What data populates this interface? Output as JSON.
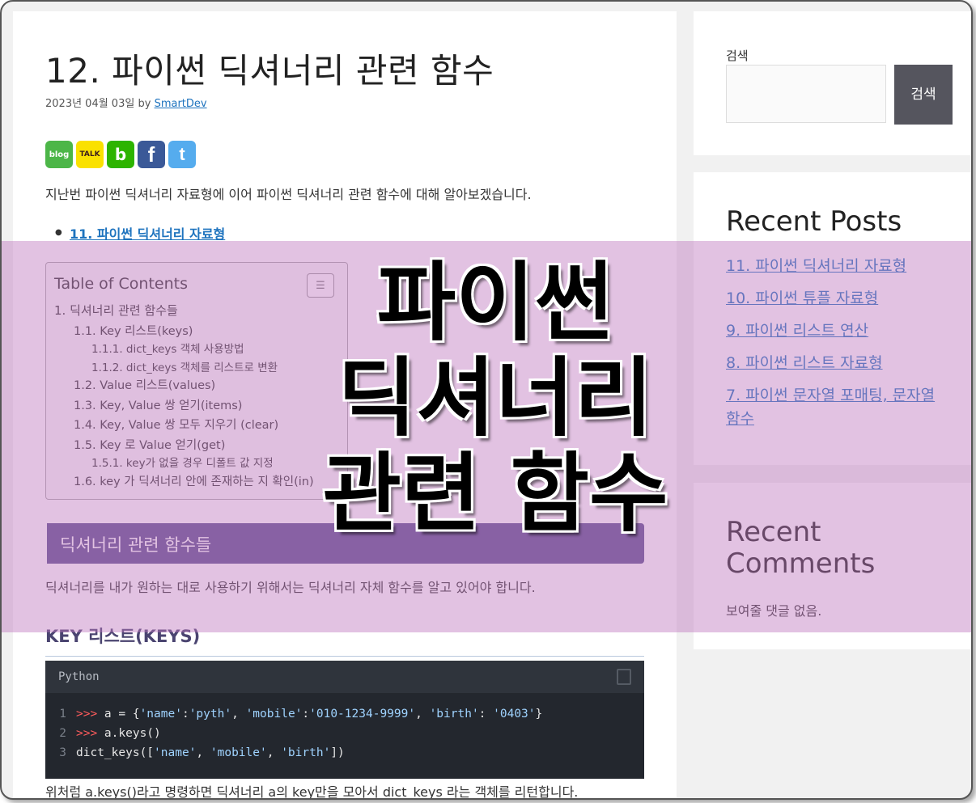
{
  "article": {
    "title": "12. 파이썬 딕셔너리 관련 함수",
    "date": "2023년 04월 03일",
    "by": "by",
    "author": "SmartDev",
    "intro": "지난번 파이썬 딕셔너리 자료형에 이어 파이썬 딕셔너리 관련 함수에 대해 알아보겠습니다.",
    "related_link": "11. 파이썬 딕셔너리 자료형",
    "share": [
      {
        "icon": "naver-blog-icon",
        "label": "blog",
        "bg": "#4cb648",
        "fg": "#ffffff"
      },
      {
        "icon": "kakao-talk-icon",
        "label": "TALK",
        "bg": "#fae100",
        "fg": "#3c1e1e"
      },
      {
        "icon": "band-icon",
        "label": "b",
        "bg": "#2db400",
        "fg": "#ffffff"
      },
      {
        "icon": "facebook-icon",
        "label": "f",
        "bg": "#3b5998",
        "fg": "#ffffff"
      },
      {
        "icon": "twitter-icon",
        "label": "t",
        "bg": "#55acee",
        "fg": "#ffffff"
      }
    ]
  },
  "toc": {
    "title": "Table of Contents",
    "toggle_icon": "☰",
    "items": [
      {
        "level": 1,
        "text": "1. 딕셔너리 관련 함수들"
      },
      {
        "level": 2,
        "text": "1.1. Key 리스트(keys)"
      },
      {
        "level": 3,
        "text": "1.1.1. dict_keys 객체 사용방법"
      },
      {
        "level": 3,
        "text": "1.1.2. dict_keys 객체를 리스트로 변환"
      },
      {
        "level": 2,
        "text": "1.2. Value 리스트(values)"
      },
      {
        "level": 2,
        "text": "1.3. Key, Value 쌍 얻기(items)"
      },
      {
        "level": 2,
        "text": "1.4. Key, Value 쌍 모두 지우기 (clear)"
      },
      {
        "level": 2,
        "text": "1.5. Key 로 Value 얻기(get)"
      },
      {
        "level": 3,
        "text": "1.5.1. key가 없을 경우 디폴트 값 지정"
      },
      {
        "level": 2,
        "text": "1.6. key 가 딕셔너리 안에 존재하는 지 확인(in)"
      }
    ]
  },
  "section": {
    "heading": "딕셔너리 관련 함수들",
    "para1": "딕셔너리를 내가 원하는 대로 사용하기 위해서는 딕셔너리 자체 함수를 알고 있어야 합니다.",
    "subheading": "KEY 리스트(KEYS)",
    "para2": "위처럼 a.keys()라고 명령하면 딕셔너리 a의 key만을 모아서 dict_keys 라는 객체를 리턴합니다."
  },
  "code": {
    "language": "Python",
    "lines": [
      {
        "num": "1",
        "prompt": ">>> ",
        "pre": "a = {",
        "s1": "'name'",
        "m1": ":",
        "s2": "'pyth'",
        "m2": ", ",
        "s3": "'mobile'",
        "m3": ":",
        "s4": "'010-1234-9999'",
        "m4": ", ",
        "s5": "'birth'",
        "m5": ": ",
        "s6": "'0403'",
        "post": "}"
      },
      {
        "num": "2",
        "prompt": ">>> ",
        "text": "a.keys()"
      },
      {
        "num": "3",
        "pre": "dict_keys([",
        "s1": "'name'",
        "m1": ", ",
        "s2": "'mobile'",
        "m2": ", ",
        "s3": "'birth'",
        "post": "])"
      }
    ]
  },
  "sidebar": {
    "search_label": "검색",
    "search_button": "검색",
    "recent_posts_title": "Recent Posts",
    "recent_posts": [
      "11. 파이썬 딕셔너리 자료형",
      "10. 파이썬 튜플 자료형",
      "9. 파이썬 리스트 연산",
      "8. 파이썬 리스트 자료형",
      "7. 파이썬 문자열 포매팅, 문자열 함수"
    ],
    "recent_comments_title": "Recent Comments",
    "recent_comments_empty": "보여줄 댓글 없음."
  },
  "banner": {
    "lines": [
      "파이썬",
      "딕셔너리",
      "관련 함수"
    ]
  },
  "colors": {
    "link": "#1e73be",
    "section_heading_bg": "#5b4f8e",
    "overlay": "#be78be",
    "code_bg": "#23272e"
  }
}
